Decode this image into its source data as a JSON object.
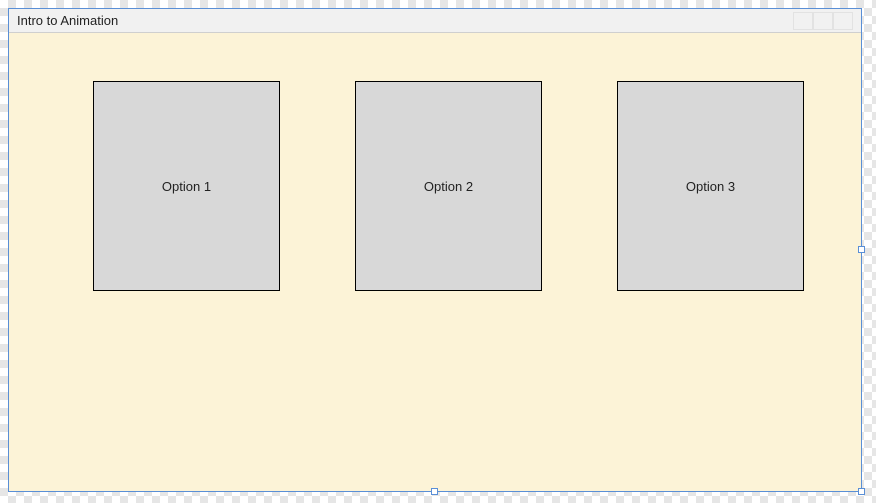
{
  "window": {
    "title": "Intro to Animation"
  },
  "options": [
    {
      "label": "Option 1"
    },
    {
      "label": "Option 2"
    },
    {
      "label": "Option 3"
    }
  ]
}
